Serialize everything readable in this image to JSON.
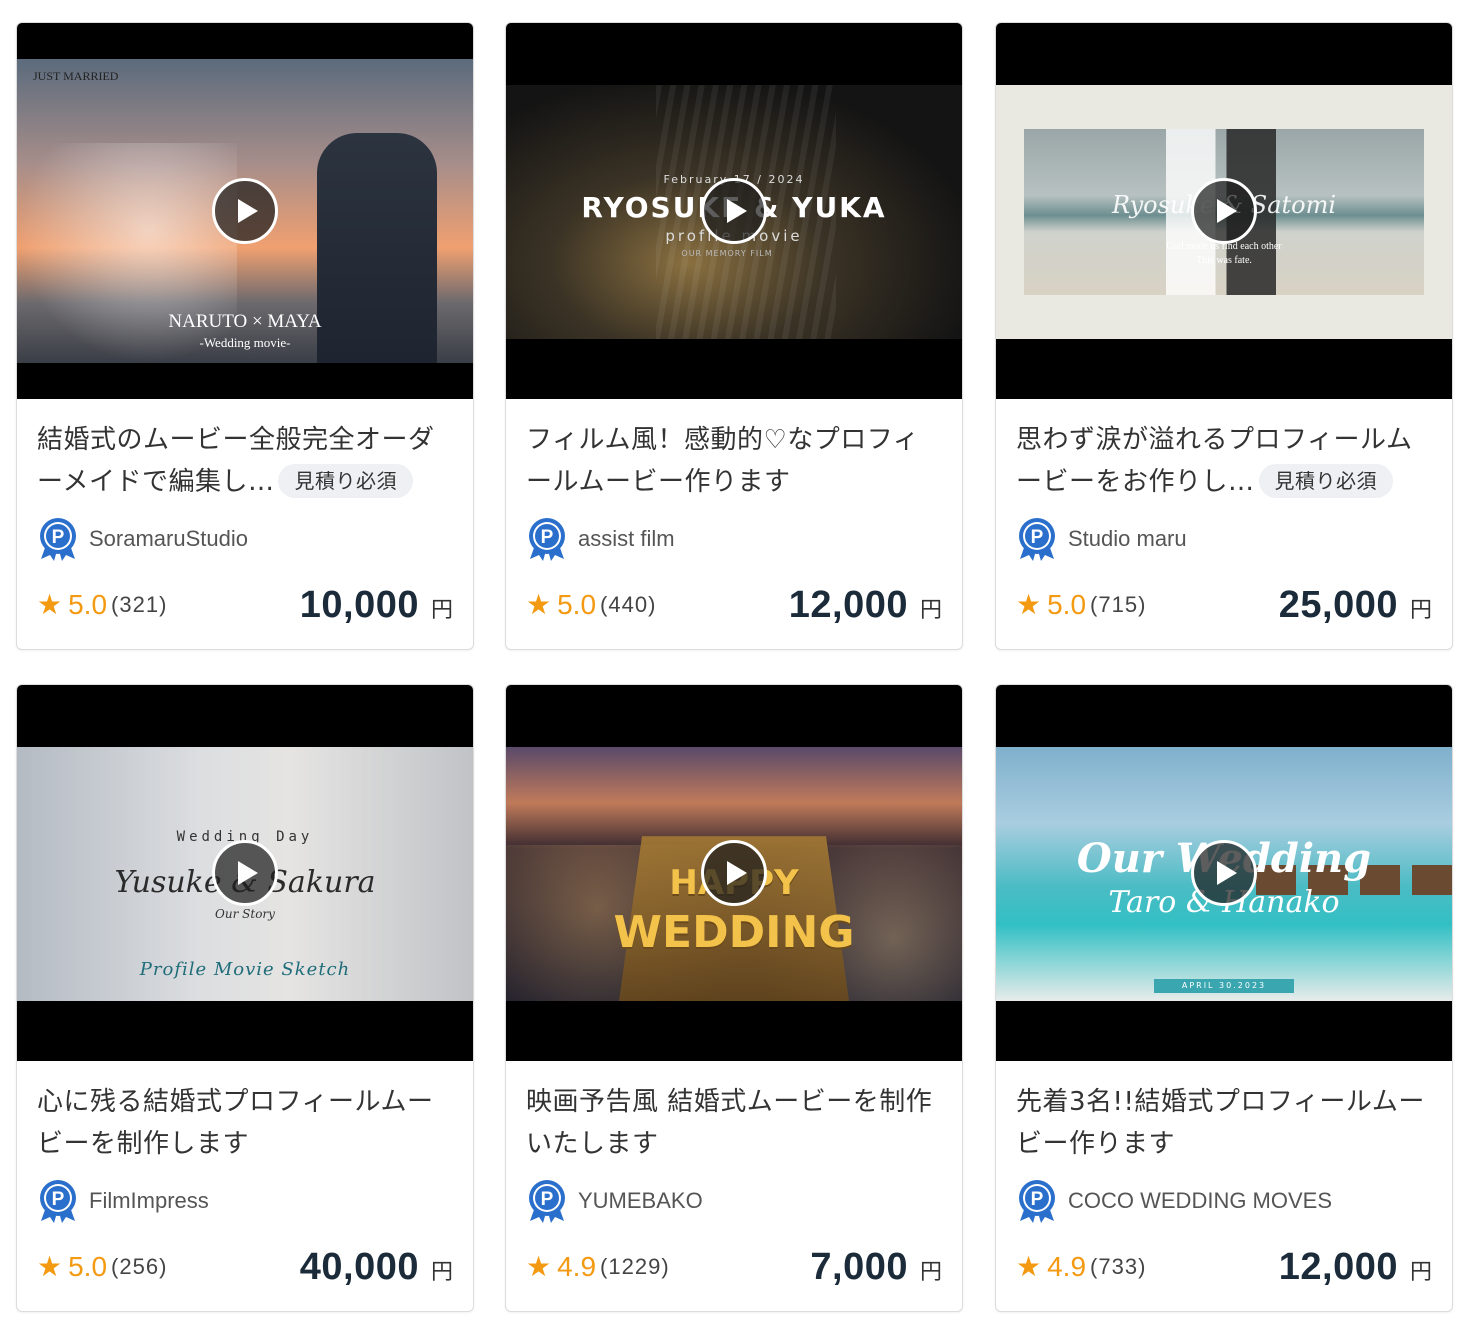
{
  "products": [
    {
      "title": "結婚式のムービー全般完全オーダーメイドで編集し…",
      "badge": "見積り必須",
      "seller": "SoramaruStudio",
      "rating": "5.0",
      "reviews": "(321)",
      "price": "10,000",
      "currency": "円",
      "thumb_text": [
        "JUST MARRIED",
        "NARUTO × MAYA",
        "-Wedding movie-"
      ]
    },
    {
      "title": "フィルム風！感動的♡なプロフィールムービー作ります",
      "badge": "",
      "seller": "assist film",
      "rating": "5.0",
      "reviews": "(440)",
      "price": "12,000",
      "currency": "円",
      "thumb_text": [
        "February 17 / 2024",
        "RYOSUKE & YUKA",
        "profile movie",
        "OUR MEMORY FILM"
      ]
    },
    {
      "title": "思わず涙が溢れるプロフィールムービーをお作りし…",
      "badge": "見積り必須",
      "seller": "Studio maru",
      "rating": "5.0",
      "reviews": "(715)",
      "price": "25,000",
      "currency": "円",
      "thumb_text": [
        "Ryosuke & Satomi",
        "God made us find each other",
        "This was fate."
      ]
    },
    {
      "title": "心に残る結婚式プロフィールムービーを制作します",
      "badge": "",
      "seller": "FilmImpress",
      "rating": "5.0",
      "reviews": "(256)",
      "price": "40,000",
      "currency": "円",
      "thumb_text": [
        "Wedding Day",
        "Yusuke & Sakura",
        "Our Story",
        "Profile Movie Sketch"
      ]
    },
    {
      "title": "映画予告風 結婚式ムービーを制作いたします",
      "badge": "",
      "seller": "YUMEBAKO",
      "rating": "4.9",
      "reviews": "(1229)",
      "price": "7,000",
      "currency": "円",
      "thumb_text": [
        "HAPPY",
        "WEDDING"
      ]
    },
    {
      "title": "先着3名!!結婚式プロフィールムービー作ります",
      "badge": "",
      "seller": "COCO WEDDING MOVES",
      "rating": "4.9",
      "reviews": "(733)",
      "price": "12,000",
      "currency": "円",
      "thumb_text": [
        "Our Wedding",
        "Taro & Hanako",
        "APRIL 30.2023"
      ]
    }
  ],
  "colors": {
    "star": "#f39a12",
    "price": "#1c2b3a",
    "badge_bg": "#eef0f3",
    "pro_badge": "#2a6fcb"
  },
  "icons": {
    "play": "play-icon",
    "seller": "pro-seller-badge-icon",
    "star": "star-icon"
  }
}
